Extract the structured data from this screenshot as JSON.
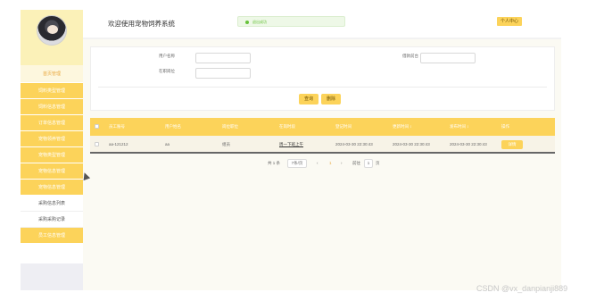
{
  "sidebar": {
    "user_name": "",
    "top_item": "首页管理",
    "items": [
      {
        "label": "饲料类型管理",
        "type": "main"
      },
      {
        "label": "饲料信息管理",
        "type": "main"
      },
      {
        "label": "订单信息管理",
        "type": "main"
      },
      {
        "label": "宠物领养管理",
        "type": "main"
      },
      {
        "label": "宠物类型管理",
        "type": "main"
      },
      {
        "label": "宠物信息管理",
        "type": "main"
      },
      {
        "label": "宠物信息管理",
        "type": "main"
      },
      {
        "label": "采购信息列表",
        "type": "sub"
      },
      {
        "label": "采购采购记录",
        "type": "sub"
      },
      {
        "label": "员工信息管理",
        "type": "main"
      }
    ]
  },
  "header": {
    "title": "欢迎使用宠物饲养系统",
    "notice": "退出成功",
    "personal_center": "个人中心"
  },
  "search": {
    "fields": [
      {
        "label": "用户名称",
        "value": "",
        "placeholder": ""
      },
      {
        "label": "在职岗位",
        "value": "",
        "placeholder": ""
      },
      {
        "label": "借款前台",
        "value": "",
        "placeholder": ""
      }
    ],
    "query_button": "查询",
    "delete_button": "删除"
  },
  "table": {
    "columns": [
      "员工账号",
      "用户姓名",
      "岗位职位",
      "在岗时段",
      "登记时间",
      "更新时间 ↕",
      "发布时间 ↕",
      "操作"
    ],
    "rows": [
      {
        "cells": [
          "aa-121212",
          "aa",
          "组员",
          "周一下班上午",
          "2024-03-30 22:30:43",
          "2024-03-30 22:30:43",
          "2024-03-30 22:30:43"
        ],
        "action": "详情"
      }
    ]
  },
  "pagination": {
    "total": "共 1 条",
    "page_size": "7条/页",
    "prev": "‹",
    "current_page": "1",
    "next": "›",
    "goto_label": "前往",
    "goto_value": "1",
    "page_unit": "页"
  },
  "watermark": "CSDN @vx_danpianji889",
  "colors": {
    "accent": "#fcd35a",
    "sidebar_profile_bg": "#fbf1b8",
    "main_bg": "#fbfaf3",
    "notice_green": "#67c23a"
  }
}
